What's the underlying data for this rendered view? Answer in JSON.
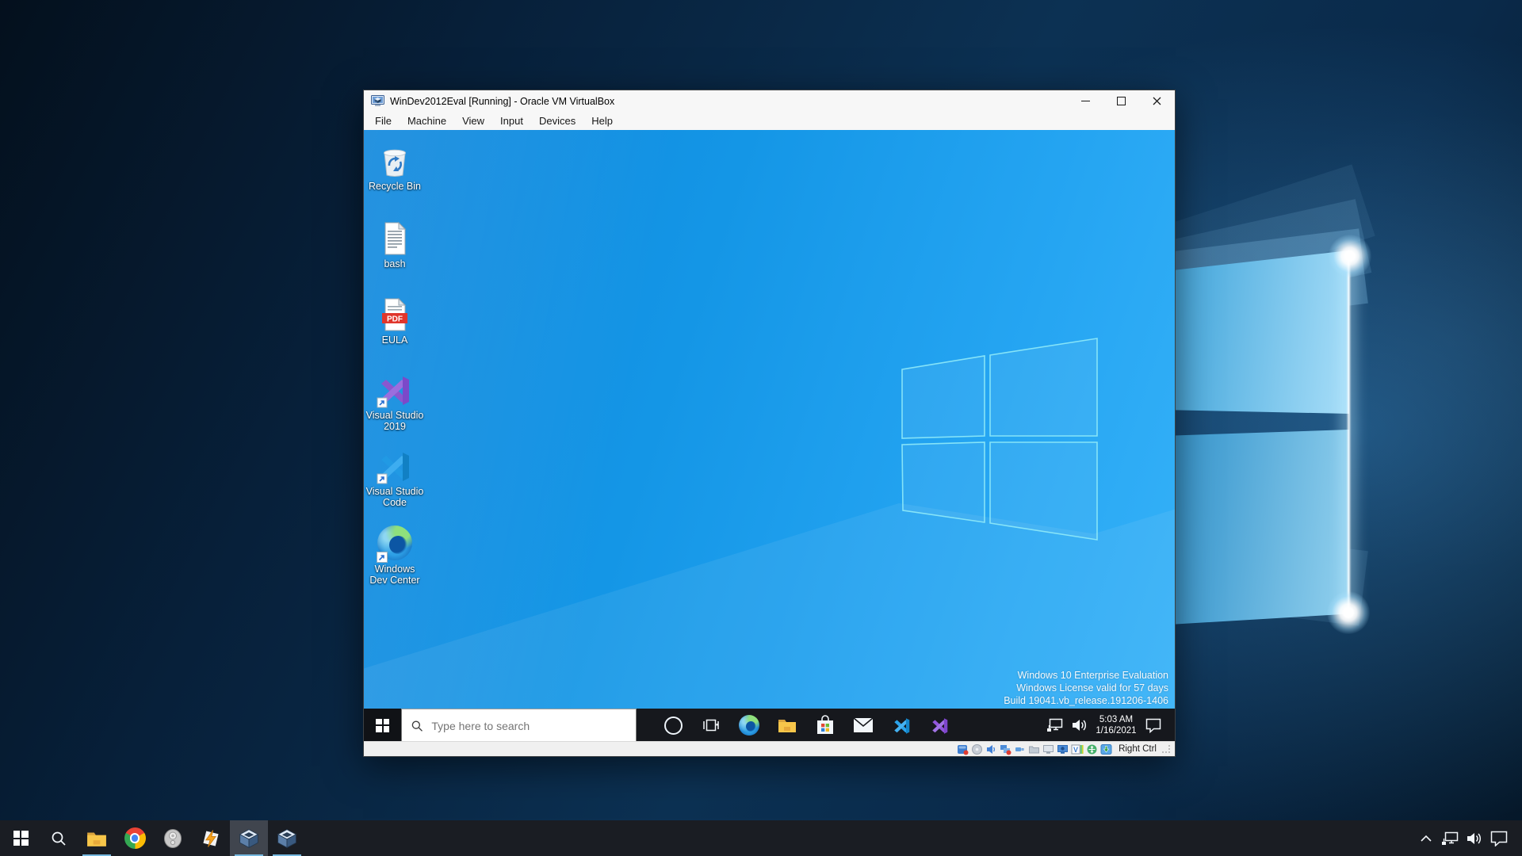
{
  "vbox": {
    "title": "WinDev2012Eval [Running] - Oracle VM VirtualBox",
    "menu": [
      {
        "label": "File"
      },
      {
        "label": "Machine"
      },
      {
        "label": "View"
      },
      {
        "label": "Input"
      },
      {
        "label": "Devices"
      },
      {
        "label": "Help"
      }
    ],
    "window_controls": [
      "minimize",
      "maximize",
      "close"
    ],
    "status": {
      "host_key_hint": "Right Ctrl",
      "icons": [
        "hard-disks",
        "optical-drives",
        "audio",
        "network",
        "usb",
        "shared-folders",
        "display",
        "recording",
        "vm-features",
        "mouse-integration",
        "keyboard-capture"
      ]
    }
  },
  "guest": {
    "desktop_icons": [
      {
        "label": "Recycle Bin",
        "icon": "recycle-bin"
      },
      {
        "label": "bash",
        "icon": "text-document"
      },
      {
        "label": "EULA",
        "icon": "pdf-document"
      },
      {
        "label": "Visual Studio 2019",
        "icon": "visual-studio-2019"
      },
      {
        "label": "Visual Studio Code",
        "icon": "visual-studio-code"
      },
      {
        "label": "Windows Dev Center",
        "icon": "edge-circle"
      }
    ],
    "watermark": {
      "line1": "Windows 10 Enterprise Evaluation",
      "line2": "Windows License valid for 57 days",
      "line3": "Build 19041.vb_release.191206-1406"
    },
    "taskbar": {
      "search_placeholder": "Type here to search",
      "icons": [
        "cortana",
        "task-view",
        "edge",
        "file-explorer",
        "store",
        "mail",
        "vs-code",
        "visual-studio"
      ],
      "tray": {
        "icons": [
          "network",
          "volume",
          "action-center"
        ],
        "time": "5:03 AM",
        "date": "1/16/2021"
      }
    }
  },
  "host": {
    "taskbar": {
      "items": [
        "start",
        "search",
        "file-explorer",
        "chrome",
        "audio-player",
        "winamp",
        "virtualbox-active",
        "virtualbox"
      ],
      "running_items": [
        "file-explorer",
        "virtualbox-active",
        "virtualbox"
      ],
      "tray_icons": [
        "hidden-icons-chevron",
        "network",
        "volume",
        "action-center"
      ]
    }
  },
  "colors": {
    "guest_wallpaper": "#1496e6",
    "host_wallpaper_dark": "#0a2a4a",
    "taskbar_dark": "#16181d",
    "accent_underline": "#76b9e0",
    "pdf_red": "#e0362c",
    "vs_purple": "#8a57cf",
    "vscode_blue": "#219ae4"
  }
}
